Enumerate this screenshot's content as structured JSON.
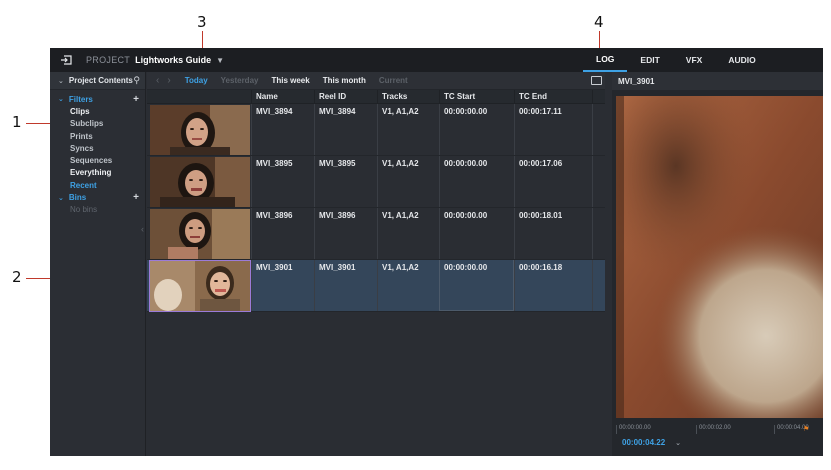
{
  "callouts": [
    "1",
    "2",
    "3",
    "4"
  ],
  "topbar": {
    "project_label": "PROJECT",
    "project_name": "Lightworks Guide",
    "tabs": [
      {
        "label": "LOG",
        "active": true
      },
      {
        "label": "EDIT",
        "active": false
      },
      {
        "label": "VFX",
        "active": false
      },
      {
        "label": "AUDIO",
        "active": false
      }
    ]
  },
  "sidebar": {
    "header": "Project Contents",
    "filters_label": "Filters",
    "items": [
      "Clips",
      "Subclips",
      "Prints",
      "Syncs",
      "Sequences",
      "Everything",
      "Recent"
    ],
    "bins_label": "Bins",
    "no_bins": "No bins"
  },
  "filters": [
    "Today",
    "Yesterday",
    "This week",
    "This month",
    "Current"
  ],
  "table": {
    "columns": [
      "Name",
      "Reel ID",
      "Tracks",
      "TC Start",
      "TC End"
    ],
    "rows": [
      {
        "name": "MVI_3894",
        "reel": "MVI_3894",
        "tracks": "V1, A1,A2",
        "tc_start": "00:00:00.00",
        "tc_end": "00:00:17.11"
      },
      {
        "name": "MVI_3895",
        "reel": "MVI_3895",
        "tracks": "V1, A1,A2",
        "tc_start": "00:00:00.00",
        "tc_end": "00:00:17.06"
      },
      {
        "name": "MVI_3896",
        "reel": "MVI_3896",
        "tracks": "V1, A1,A2",
        "tc_start": "00:00:00.00",
        "tc_end": "00:00:18.01"
      },
      {
        "name": "MVI_3901",
        "reel": "MVI_3901",
        "tracks": "V1, A1,A2",
        "tc_start": "00:00:00.00",
        "tc_end": "00:00:16.18"
      }
    ]
  },
  "viewer": {
    "title": "MVI_3901",
    "ticks": [
      "00:00:00.00",
      "00:00:02.00",
      "00:00:04.00"
    ],
    "timecode": "00:00:04.22"
  },
  "colors": {
    "accent": "#3ea1e4",
    "selected_row": "#34465a",
    "callout_line": "#c0392b"
  }
}
